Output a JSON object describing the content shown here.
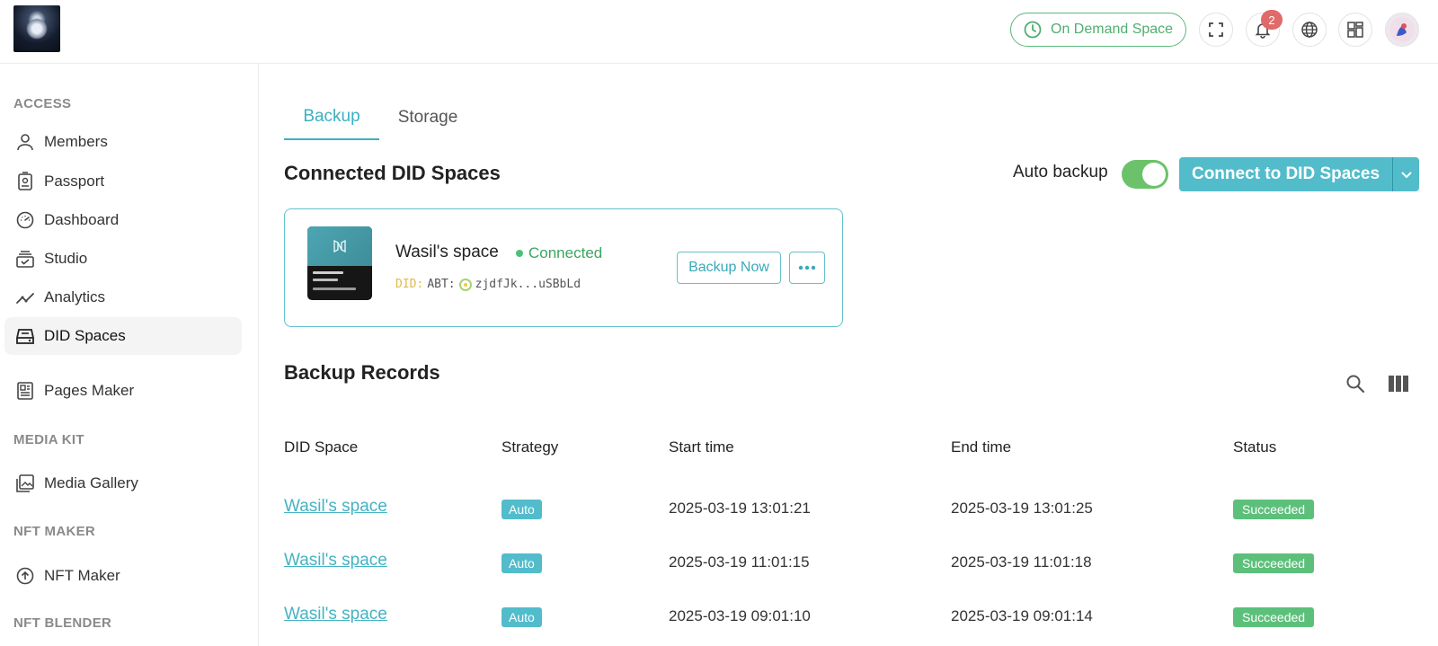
{
  "header": {
    "on_demand_label": "On Demand Space",
    "notification_count": "2"
  },
  "sidebar": {
    "sections": [
      {
        "title": "ACCESS"
      },
      {
        "title": "MEDIA KIT"
      },
      {
        "title": "NFT MAKER"
      },
      {
        "title": "NFT BLENDER"
      }
    ],
    "items": [
      {
        "label": "Members",
        "icon": "person-icon"
      },
      {
        "label": "Passport",
        "icon": "passport-icon"
      },
      {
        "label": "Dashboard",
        "icon": "gauge-icon"
      },
      {
        "label": "Studio",
        "icon": "studio-icon"
      },
      {
        "label": "Analytics",
        "icon": "analytics-icon"
      },
      {
        "label": "DID Spaces",
        "icon": "drive-icon",
        "active": true
      },
      {
        "label": "Pages Maker",
        "icon": "pages-icon"
      },
      {
        "label": "Media Gallery",
        "icon": "gallery-icon"
      },
      {
        "label": "NFT Maker",
        "icon": "upload-circle-icon"
      }
    ]
  },
  "tabs": [
    {
      "label": "Backup",
      "active": true
    },
    {
      "label": "Storage",
      "active": false
    }
  ],
  "connected": {
    "title": "Connected DID Spaces",
    "auto_backup_label": "Auto backup",
    "auto_backup_on": true,
    "connect_label": "Connect to DID Spaces",
    "card": {
      "name": "Wasil's space",
      "status": "Connected",
      "did_prefix": "DID:",
      "did_type": "ABT:",
      "did_value": "zjdfJk...uSBbLd",
      "backup_now_label": "Backup Now"
    }
  },
  "records": {
    "title": "Backup Records",
    "columns": [
      "DID Space",
      "Strategy",
      "Start time",
      "End time",
      "Status"
    ],
    "rows": [
      {
        "space": "Wasil's space",
        "strategy": "Auto",
        "start": "2025-03-19 13:01:21",
        "end": "2025-03-19 13:01:25",
        "status": "Succeeded"
      },
      {
        "space": "Wasil's space",
        "strategy": "Auto",
        "start": "2025-03-19 11:01:15",
        "end": "2025-03-19 11:01:18",
        "status": "Succeeded"
      },
      {
        "space": "Wasil's space",
        "strategy": "Auto",
        "start": "2025-03-19 09:01:10",
        "end": "2025-03-19 09:01:14",
        "status": "Succeeded"
      }
    ]
  },
  "colors": {
    "accent": "#52bccb",
    "success": "#5cc07b",
    "on_demand": "#4fae70"
  }
}
